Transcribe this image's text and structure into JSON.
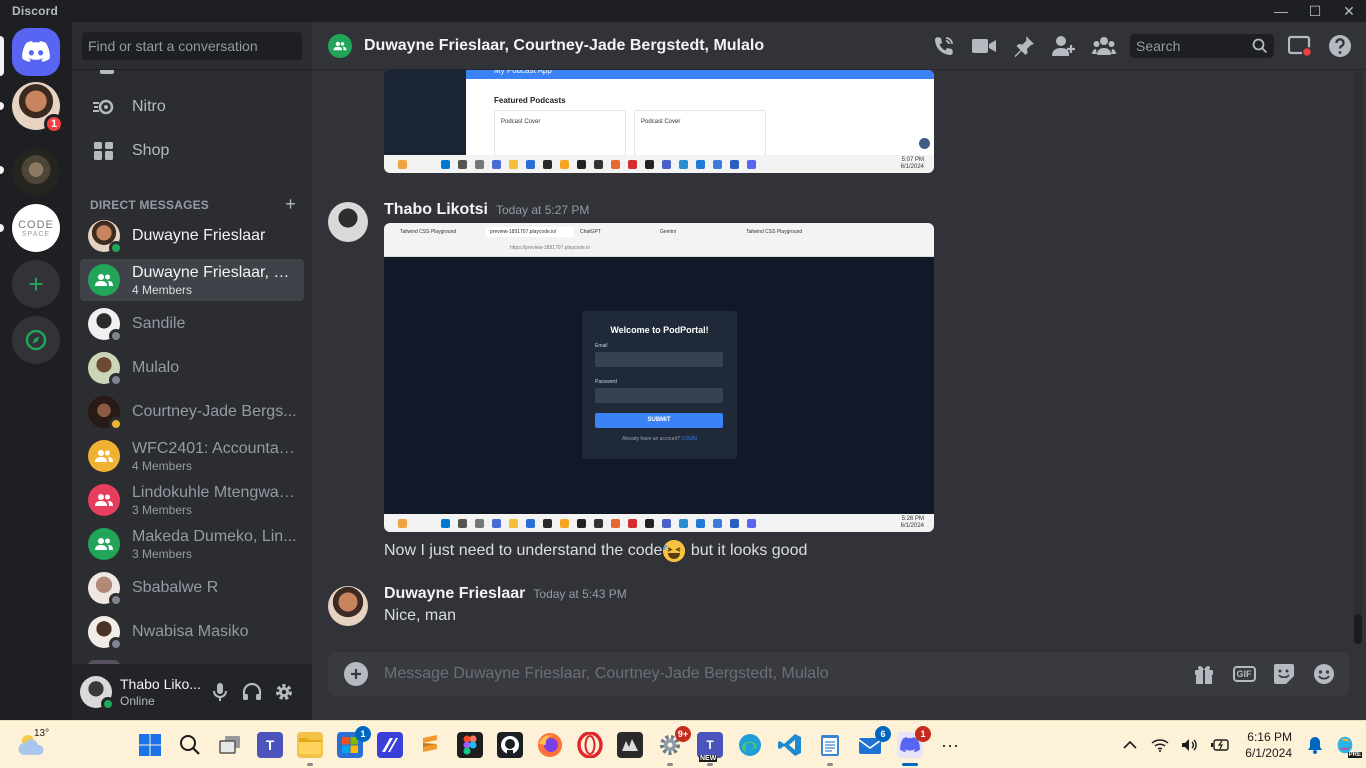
{
  "window": {
    "app_name": "Discord",
    "controls": {
      "minimize": "—",
      "maximize": "☐",
      "close": "✕"
    }
  },
  "servers": {
    "home_label": "Direct Messages",
    "items": [
      {
        "name": "Duwayne server",
        "badge": "1"
      },
      {
        "name": "Meerkat server"
      },
      {
        "name": "CodeSpace",
        "logo_text_top": "CODE",
        "logo_text_bottom": "SPACE"
      }
    ],
    "add_label": "+"
  },
  "sidebar": {
    "search_placeholder": "Find or start a conversation",
    "nav": [
      {
        "label": "Nitro",
        "icon": "nitro-icon"
      },
      {
        "label": "Shop",
        "icon": "shop-icon"
      }
    ],
    "dm_header": "DIRECT MESSAGES",
    "dm_add": "+",
    "dms": [
      {
        "name": "Duwayne Frieslaar",
        "sub": "",
        "status": "online"
      },
      {
        "name": "Duwayne Frieslaar, Co...",
        "sub": "4 Members",
        "group": true,
        "color": "#23a559"
      },
      {
        "name": "Sandile",
        "sub": "",
        "status": "offline"
      },
      {
        "name": "Mulalo",
        "sub": "",
        "status": "offline"
      },
      {
        "name": "Courtney-Jade Bergs...",
        "sub": "",
        "status": "idle"
      },
      {
        "name": "WFC2401: Accountabi...",
        "sub": "4 Members",
        "group": true,
        "color": "#f0b232"
      },
      {
        "name": "Lindokuhle Mtengwan...",
        "sub": "3 Members",
        "group": true,
        "color": "#e63e5c"
      },
      {
        "name": "Makeda Dumeko, Lin...",
        "sub": "3 Members",
        "group": true,
        "color": "#23a559"
      },
      {
        "name": "Sbabalwe R",
        "sub": "",
        "status": "offline"
      },
      {
        "name": "Nwabisa Masiko",
        "sub": "",
        "status": "offline"
      }
    ]
  },
  "user_panel": {
    "name": "Thabo Liko...",
    "status": "Online"
  },
  "channel": {
    "title": "Duwayne Frieslaar, Courtney-Jade Bergstedt, Mulalo",
    "search_placeholder": "Search"
  },
  "messages": {
    "top_attachment": {
      "banner_text": "My Podcast App",
      "section_title": "Featured Podcasts",
      "card_1": "Podcast Cover",
      "card_2": "Podcast Cover",
      "time": "5:07 PM",
      "date": "6/1/2024"
    },
    "m1": {
      "author": "Thabo Likotsi",
      "time": "Today at 5:27 PM",
      "attachment": {
        "tabs": [
          "Tailwind CSS Playground",
          "preview-1891707.playcode.io/",
          "ChatGPT",
          "Gemini",
          "Tailwind CSS Playground"
        ],
        "url": "https://preview-1891707.playcode.io",
        "login_title": "Welcome to PodPortal!",
        "email_label": "Email",
        "password_label": "Password",
        "submit_label": "SUBMIT",
        "account_text": "Already have an account?",
        "login_link": "LOGIN",
        "time": "5:26 PM",
        "date": "6/1/2024"
      },
      "text_before": "Now I just need to understand the code",
      "text_after": " but it looks good"
    },
    "m2": {
      "author": "Duwayne Frieslaar",
      "time": "Today at 5:43 PM",
      "text": "Nice, man"
    }
  },
  "composer": {
    "placeholder": "Message Duwayne Frieslaar, Courtney-Jade Bergstedt, Mulalo",
    "gif_label": "GIF"
  },
  "taskbar": {
    "temperature": "13°",
    "apps": [
      {
        "name": "start",
        "badge": ""
      },
      {
        "name": "search",
        "badge": ""
      },
      {
        "name": "task-view",
        "badge": ""
      },
      {
        "name": "teams",
        "badge": ""
      },
      {
        "name": "file-explorer",
        "badge": ""
      },
      {
        "name": "microsoft-store",
        "badge": "1"
      },
      {
        "name": "vector-app",
        "badge": ""
      },
      {
        "name": "sublime-app",
        "badge": ""
      },
      {
        "name": "figma",
        "badge": ""
      },
      {
        "name": "github",
        "badge": ""
      },
      {
        "name": "firefox",
        "badge": ""
      },
      {
        "name": "opera",
        "badge": ""
      },
      {
        "name": "media-app",
        "badge": ""
      },
      {
        "name": "settings-app",
        "badge": "9+"
      },
      {
        "name": "teams-new",
        "badge": "",
        "label": "NEW"
      },
      {
        "name": "edge",
        "badge": ""
      },
      {
        "name": "vscode",
        "badge": ""
      },
      {
        "name": "notepad",
        "badge": ""
      },
      {
        "name": "mail",
        "badge": "6"
      },
      {
        "name": "discord",
        "badge": "1"
      }
    ],
    "more": "···",
    "clock_time": "6:16 PM",
    "clock_date": "6/1/2024",
    "copilot_label": "PRE"
  }
}
